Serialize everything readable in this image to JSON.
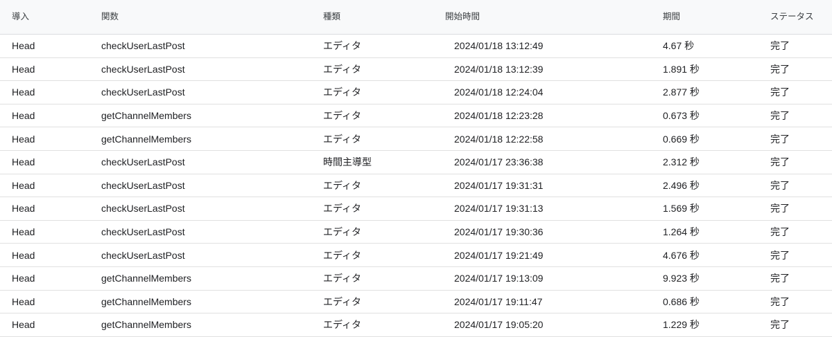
{
  "columns": {
    "deployment": "導入",
    "function": "関数",
    "type": "種類",
    "start_time": "開始時間",
    "duration": "期間",
    "status": "ステータス"
  },
  "rows": [
    {
      "deployment": "Head",
      "function": "checkUserLastPost",
      "type": "エディタ",
      "start_time": "2024/01/18 13:12:49",
      "duration": "4.67 秒",
      "status": "完了"
    },
    {
      "deployment": "Head",
      "function": "checkUserLastPost",
      "type": "エディタ",
      "start_time": "2024/01/18 13:12:39",
      "duration": "1.891 秒",
      "status": "完了"
    },
    {
      "deployment": "Head",
      "function": "checkUserLastPost",
      "type": "エディタ",
      "start_time": "2024/01/18 12:24:04",
      "duration": "2.877 秒",
      "status": "完了"
    },
    {
      "deployment": "Head",
      "function": "getChannelMembers",
      "type": "エディタ",
      "start_time": "2024/01/18 12:23:28",
      "duration": "0.673 秒",
      "status": "完了"
    },
    {
      "deployment": "Head",
      "function": "getChannelMembers",
      "type": "エディタ",
      "start_time": "2024/01/18 12:22:58",
      "duration": "0.669 秒",
      "status": "完了"
    },
    {
      "deployment": "Head",
      "function": "checkUserLastPost",
      "type": "時間主導型",
      "start_time": "2024/01/17 23:36:38",
      "duration": "2.312 秒",
      "status": "完了"
    },
    {
      "deployment": "Head",
      "function": "checkUserLastPost",
      "type": "エディタ",
      "start_time": "2024/01/17 19:31:31",
      "duration": "2.496 秒",
      "status": "完了"
    },
    {
      "deployment": "Head",
      "function": "checkUserLastPost",
      "type": "エディタ",
      "start_time": "2024/01/17 19:31:13",
      "duration": "1.569 秒",
      "status": "完了"
    },
    {
      "deployment": "Head",
      "function": "checkUserLastPost",
      "type": "エディタ",
      "start_time": "2024/01/17 19:30:36",
      "duration": "1.264 秒",
      "status": "完了"
    },
    {
      "deployment": "Head",
      "function": "checkUserLastPost",
      "type": "エディタ",
      "start_time": "2024/01/17 19:21:49",
      "duration": "4.676 秒",
      "status": "完了"
    },
    {
      "deployment": "Head",
      "function": "getChannelMembers",
      "type": "エディタ",
      "start_time": "2024/01/17 19:13:09",
      "duration": "9.923 秒",
      "status": "完了"
    },
    {
      "deployment": "Head",
      "function": "getChannelMembers",
      "type": "エディタ",
      "start_time": "2024/01/17 19:11:47",
      "duration": "0.686 秒",
      "status": "完了"
    },
    {
      "deployment": "Head",
      "function": "getChannelMembers",
      "type": "エディタ",
      "start_time": "2024/01/17 19:05:20",
      "duration": "1.229 秒",
      "status": "完了"
    }
  ]
}
